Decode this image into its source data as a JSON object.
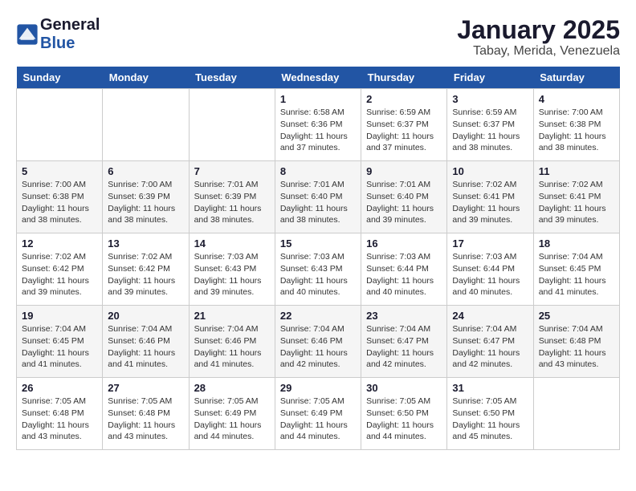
{
  "logo": {
    "line1": "General",
    "line2": "Blue"
  },
  "title": "January 2025",
  "subtitle": "Tabay, Merida, Venezuela",
  "days_of_week": [
    "Sunday",
    "Monday",
    "Tuesday",
    "Wednesday",
    "Thursday",
    "Friday",
    "Saturday"
  ],
  "weeks": [
    [
      {
        "day": null,
        "info": null
      },
      {
        "day": null,
        "info": null
      },
      {
        "day": null,
        "info": null
      },
      {
        "day": "1",
        "info": "Sunrise: 6:58 AM\nSunset: 6:36 PM\nDaylight: 11 hours and 37 minutes."
      },
      {
        "day": "2",
        "info": "Sunrise: 6:59 AM\nSunset: 6:37 PM\nDaylight: 11 hours and 37 minutes."
      },
      {
        "day": "3",
        "info": "Sunrise: 6:59 AM\nSunset: 6:37 PM\nDaylight: 11 hours and 38 minutes."
      },
      {
        "day": "4",
        "info": "Sunrise: 7:00 AM\nSunset: 6:38 PM\nDaylight: 11 hours and 38 minutes."
      }
    ],
    [
      {
        "day": "5",
        "info": "Sunrise: 7:00 AM\nSunset: 6:38 PM\nDaylight: 11 hours and 38 minutes."
      },
      {
        "day": "6",
        "info": "Sunrise: 7:00 AM\nSunset: 6:39 PM\nDaylight: 11 hours and 38 minutes."
      },
      {
        "day": "7",
        "info": "Sunrise: 7:01 AM\nSunset: 6:39 PM\nDaylight: 11 hours and 38 minutes."
      },
      {
        "day": "8",
        "info": "Sunrise: 7:01 AM\nSunset: 6:40 PM\nDaylight: 11 hours and 38 minutes."
      },
      {
        "day": "9",
        "info": "Sunrise: 7:01 AM\nSunset: 6:40 PM\nDaylight: 11 hours and 39 minutes."
      },
      {
        "day": "10",
        "info": "Sunrise: 7:02 AM\nSunset: 6:41 PM\nDaylight: 11 hours and 39 minutes."
      },
      {
        "day": "11",
        "info": "Sunrise: 7:02 AM\nSunset: 6:41 PM\nDaylight: 11 hours and 39 minutes."
      }
    ],
    [
      {
        "day": "12",
        "info": "Sunrise: 7:02 AM\nSunset: 6:42 PM\nDaylight: 11 hours and 39 minutes."
      },
      {
        "day": "13",
        "info": "Sunrise: 7:02 AM\nSunset: 6:42 PM\nDaylight: 11 hours and 39 minutes."
      },
      {
        "day": "14",
        "info": "Sunrise: 7:03 AM\nSunset: 6:43 PM\nDaylight: 11 hours and 39 minutes."
      },
      {
        "day": "15",
        "info": "Sunrise: 7:03 AM\nSunset: 6:43 PM\nDaylight: 11 hours and 40 minutes."
      },
      {
        "day": "16",
        "info": "Sunrise: 7:03 AM\nSunset: 6:44 PM\nDaylight: 11 hours and 40 minutes."
      },
      {
        "day": "17",
        "info": "Sunrise: 7:03 AM\nSunset: 6:44 PM\nDaylight: 11 hours and 40 minutes."
      },
      {
        "day": "18",
        "info": "Sunrise: 7:04 AM\nSunset: 6:45 PM\nDaylight: 11 hours and 41 minutes."
      }
    ],
    [
      {
        "day": "19",
        "info": "Sunrise: 7:04 AM\nSunset: 6:45 PM\nDaylight: 11 hours and 41 minutes."
      },
      {
        "day": "20",
        "info": "Sunrise: 7:04 AM\nSunset: 6:46 PM\nDaylight: 11 hours and 41 minutes."
      },
      {
        "day": "21",
        "info": "Sunrise: 7:04 AM\nSunset: 6:46 PM\nDaylight: 11 hours and 41 minutes."
      },
      {
        "day": "22",
        "info": "Sunrise: 7:04 AM\nSunset: 6:46 PM\nDaylight: 11 hours and 42 minutes."
      },
      {
        "day": "23",
        "info": "Sunrise: 7:04 AM\nSunset: 6:47 PM\nDaylight: 11 hours and 42 minutes."
      },
      {
        "day": "24",
        "info": "Sunrise: 7:04 AM\nSunset: 6:47 PM\nDaylight: 11 hours and 42 minutes."
      },
      {
        "day": "25",
        "info": "Sunrise: 7:04 AM\nSunset: 6:48 PM\nDaylight: 11 hours and 43 minutes."
      }
    ],
    [
      {
        "day": "26",
        "info": "Sunrise: 7:05 AM\nSunset: 6:48 PM\nDaylight: 11 hours and 43 minutes."
      },
      {
        "day": "27",
        "info": "Sunrise: 7:05 AM\nSunset: 6:48 PM\nDaylight: 11 hours and 43 minutes."
      },
      {
        "day": "28",
        "info": "Sunrise: 7:05 AM\nSunset: 6:49 PM\nDaylight: 11 hours and 44 minutes."
      },
      {
        "day": "29",
        "info": "Sunrise: 7:05 AM\nSunset: 6:49 PM\nDaylight: 11 hours and 44 minutes."
      },
      {
        "day": "30",
        "info": "Sunrise: 7:05 AM\nSunset: 6:50 PM\nDaylight: 11 hours and 44 minutes."
      },
      {
        "day": "31",
        "info": "Sunrise: 7:05 AM\nSunset: 6:50 PM\nDaylight: 11 hours and 45 minutes."
      },
      {
        "day": null,
        "info": null
      }
    ]
  ]
}
